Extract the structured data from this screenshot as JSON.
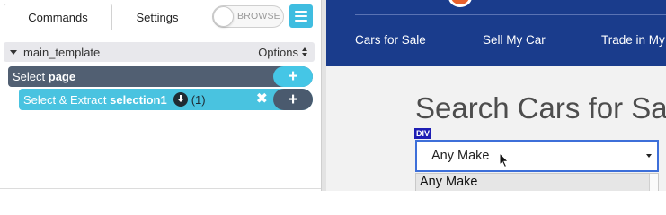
{
  "extension": {
    "tabs": [
      {
        "label": "Commands"
      },
      {
        "label": "Settings"
      }
    ],
    "browse_toggle_label": "BROWSE",
    "template": {
      "name": "main_template",
      "options_label": "Options"
    },
    "commands": [
      {
        "prefix": "Select",
        "target": "page"
      },
      {
        "prefix": "Select & Extract",
        "target": "selection1",
        "count": "(1)"
      }
    ],
    "plus_symbol": "+",
    "close_symbol": "✖"
  },
  "website": {
    "nav": [
      {
        "label": "Cars for Sale"
      },
      {
        "label": "Sell My Car"
      },
      {
        "label": "Trade in My"
      }
    ],
    "heading": "Search Cars for Sale",
    "element_badge": "DIV",
    "make_select": {
      "value": "Any Make",
      "options_visible": [
        "Any Make"
      ]
    }
  },
  "colors": {
    "header_blue": "#1a3c8c",
    "accent_cyan": "#49c3e0",
    "command_slate": "#515f72",
    "select_border": "#3d6fd9"
  }
}
